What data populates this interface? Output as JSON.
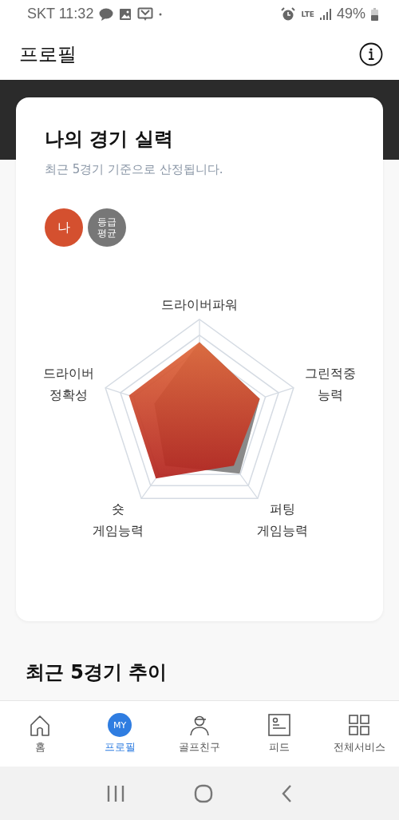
{
  "status_bar": {
    "carrier_time": "SKT 11:32",
    "network": "LTE",
    "battery": "49%"
  },
  "header": {
    "title": "프로필"
  },
  "skill_card": {
    "title": "나의 경기 실력",
    "subtitle": "최근 5경기 기준으로 산정됩니다.",
    "legend": [
      {
        "label": "나",
        "color": "#d4502f"
      },
      {
        "label": "등급\n평균",
        "color": "#777777"
      }
    ],
    "radar": {
      "axes": [
        {
          "label": "드라이버파워"
        },
        {
          "label": "드라이버\n정확성"
        },
        {
          "label": "그린적중\n능력"
        },
        {
          "label": "숏\n게임능력"
        },
        {
          "label": "퍼팅\n게임능력"
        }
      ]
    }
  },
  "trend_section": {
    "title": "최근 5경기 추이"
  },
  "bottom_nav": [
    {
      "label": "홈",
      "kind": "home",
      "selected": false
    },
    {
      "label": "프로필",
      "kind": "badge",
      "badge": "MY",
      "selected": true
    },
    {
      "label": "골프친구",
      "kind": "friends",
      "selected": false
    },
    {
      "label": "피드",
      "kind": "feed",
      "selected": false
    },
    {
      "label": "전체서비스",
      "kind": "all",
      "selected": false
    }
  ]
}
